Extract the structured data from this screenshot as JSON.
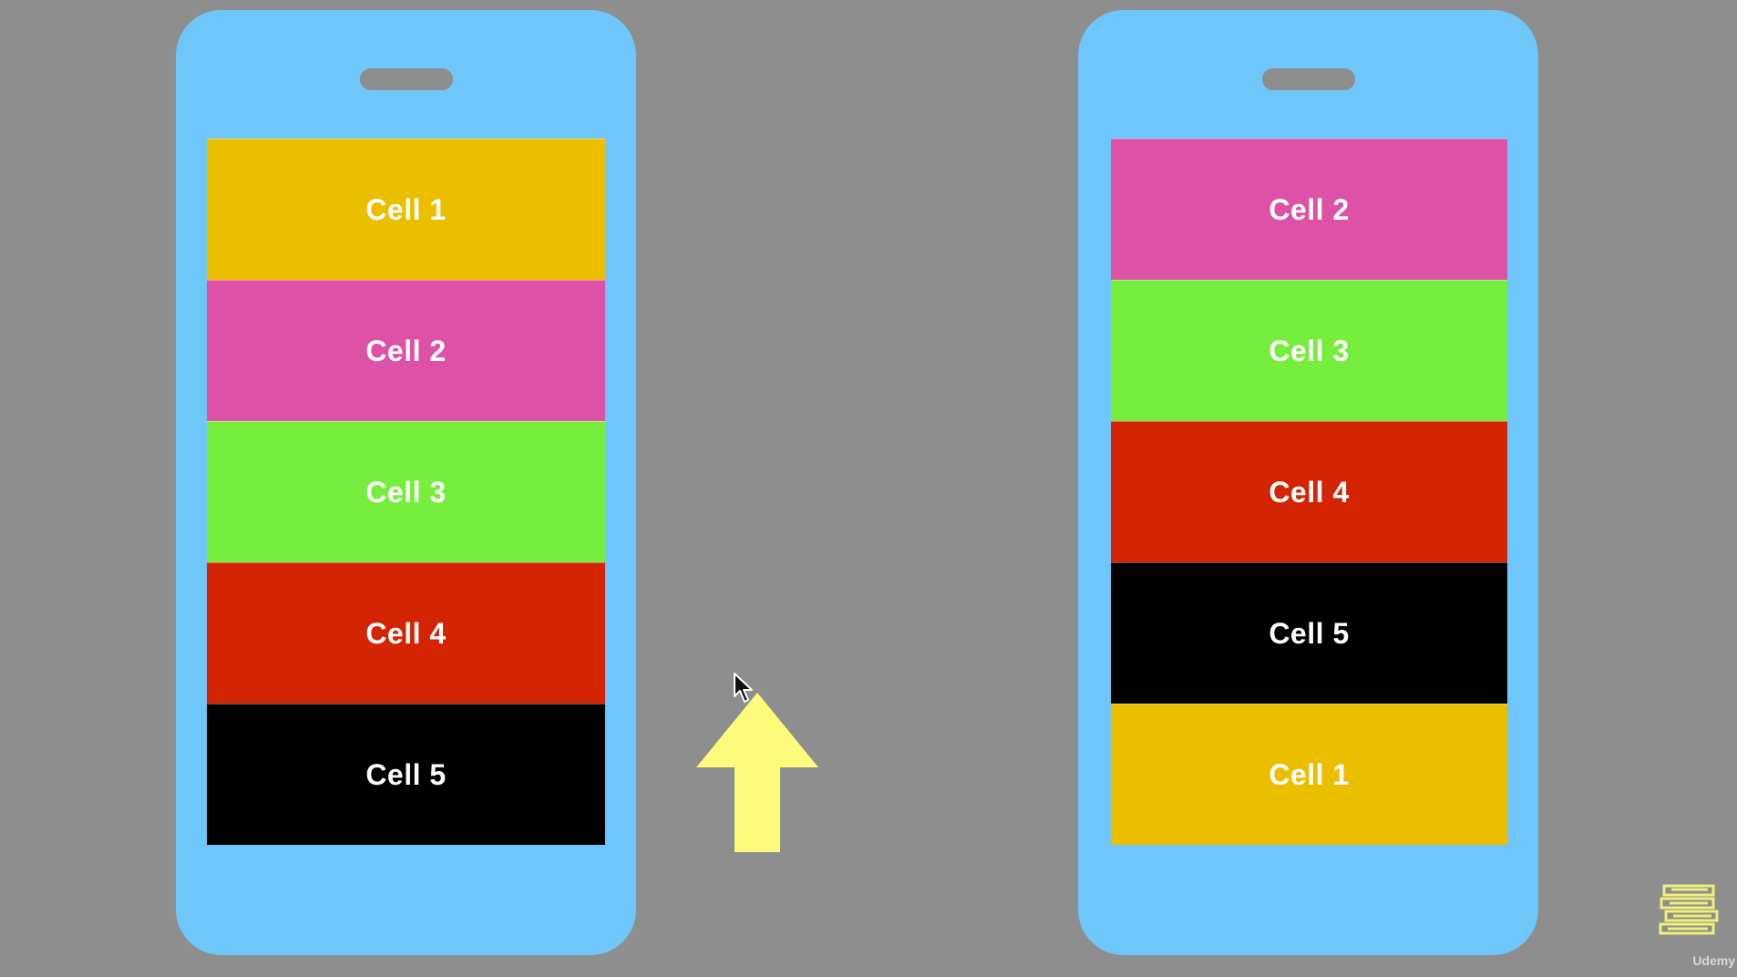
{
  "phones": [
    {
      "cells": [
        {
          "label": "Cell 1",
          "color": "#ecbe00"
        },
        {
          "label": "Cell 2",
          "color": "#dd52a7"
        },
        {
          "label": "Cell 3",
          "color": "#77ee3d"
        },
        {
          "label": "Cell 4",
          "color": "#d52404"
        },
        {
          "label": "Cell 5",
          "color": "#000000"
        }
      ]
    },
    {
      "cells": [
        {
          "label": "Cell 2",
          "color": "#dd52a7"
        },
        {
          "label": "Cell 3",
          "color": "#77ee3d"
        },
        {
          "label": "Cell 4",
          "color": "#d52404"
        },
        {
          "label": "Cell 5",
          "color": "#000000"
        },
        {
          "label": "Cell 1",
          "color": "#ecbe00"
        }
      ]
    }
  ],
  "colors": {
    "background": "#8e8e8e",
    "phone": "#6ec6fb",
    "arrow": "#fcfb7b"
  },
  "icons": {
    "arrow": "up-arrow-icon",
    "cursor": "mouse-cursor-icon",
    "watermark": "books-icon"
  },
  "watermark": {
    "brand": "Udemy"
  }
}
